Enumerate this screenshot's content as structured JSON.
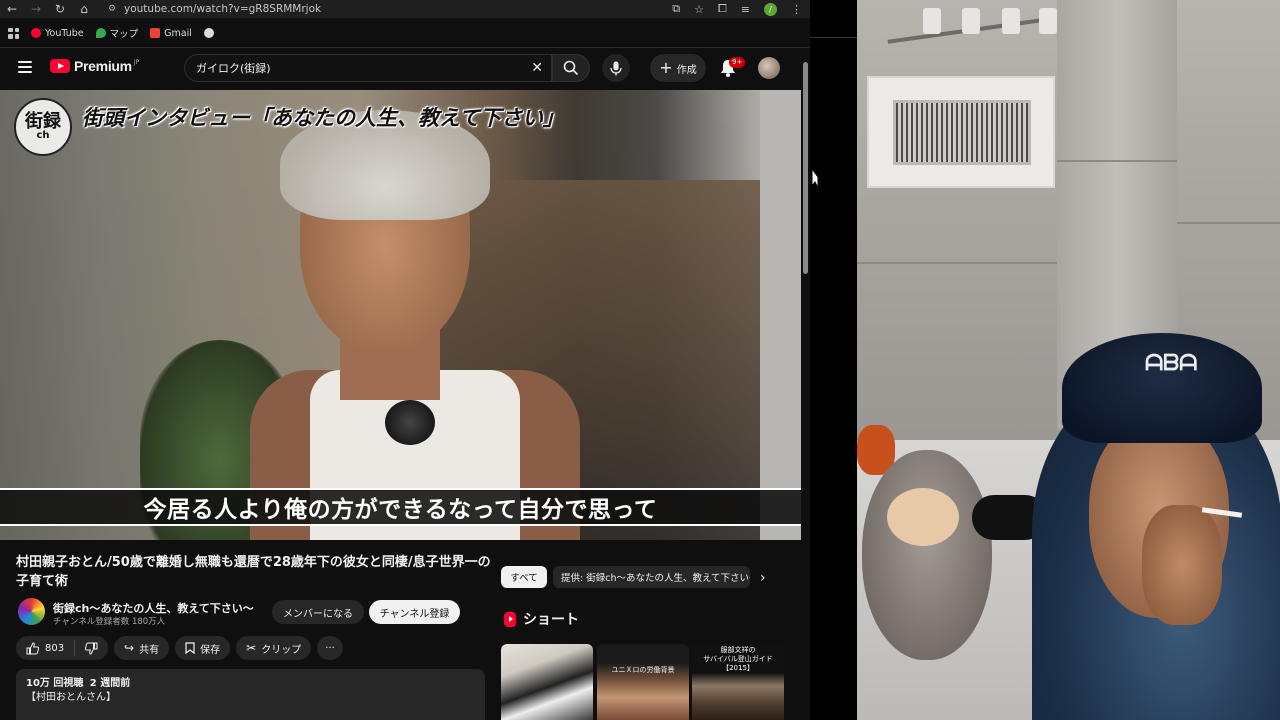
{
  "browser": {
    "url": "youtube.com/watch?v=gR8SRMMrjok",
    "bookmarks": [
      {
        "label": "YouTube",
        "color": "#ff0033"
      },
      {
        "label": "マップ",
        "color": "#34a853"
      },
      {
        "label": "Gmail",
        "color": "#ea4335"
      }
    ],
    "profile_initial": "/"
  },
  "header": {
    "logo_text": "Premium",
    "logo_region": "JP",
    "search_value": "ガイロク(街録)",
    "create_label": "作成",
    "notification_count": "9+"
  },
  "video": {
    "logo_top": "街録",
    "logo_bottom": "ch",
    "overlay_title": "街頭インタビュー「あなたの人生、教えて下さい」",
    "subtitle": "今居る人より俺の方ができるなって自分で思って",
    "title": "村田親子おとん/50歳で離婚し無職も還暦で28歳年下の彼女と同棲/息子世界一の子育て術"
  },
  "channel": {
    "name": "街録ch〜あなたの人生、教えて下さい〜",
    "subscribers": "チャンネル登録者数 180万人",
    "member_label": "メンバーになる",
    "subscribe_label": "チャンネル登録"
  },
  "actions": {
    "likes": "803",
    "share": "共有",
    "save": "保存",
    "clip": "クリップ",
    "more": "···"
  },
  "description": {
    "views": "10万 回視聴",
    "age": "2 週間前",
    "first_line": "【村田おとんさん】"
  },
  "sidebar": {
    "chip_all": "すべて",
    "chip_provider": "提供: 街録ch〜あなたの人生、教えて下さい〜",
    "shorts_heading": "ショート",
    "shorts": [
      {
        "label": ""
      },
      {
        "label": "ユニＸロの労働背景"
      },
      {
        "label": "服部文祥の\nサバイバル登山ガイド\n【2015】"
      }
    ]
  },
  "colors": {
    "background": "#0f0f0f",
    "accent": "#ff0033",
    "chip_dark": "#272727"
  }
}
